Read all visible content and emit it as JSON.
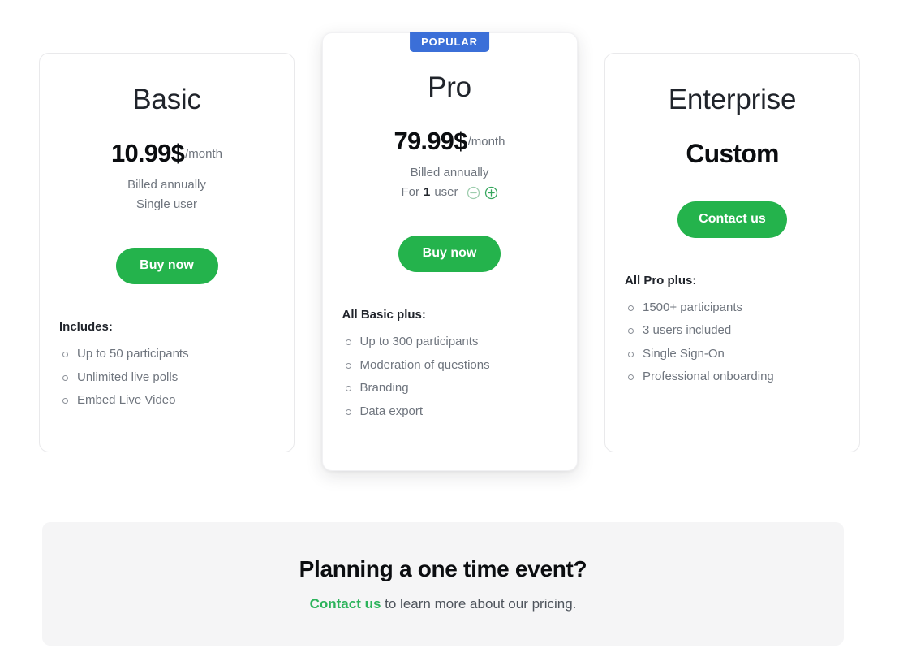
{
  "plans": [
    {
      "id": "basic",
      "name": "Basic",
      "featured": false,
      "badge": null,
      "price_amount": "10.99$",
      "price_period": "/month",
      "billing_note": "Billed annually",
      "seat_note": "Single user",
      "has_stepper": false,
      "cta_label": "Buy now",
      "features_title": "Includes:",
      "features": [
        "Up to 50 participants",
        "Unlimited live polls",
        "Embed Live Video"
      ]
    },
    {
      "id": "pro",
      "name": "Pro",
      "featured": true,
      "badge": "POPULAR",
      "price_amount": "79.99$",
      "price_period": "/month",
      "billing_note": "Billed annually",
      "seat_prefix": "For",
      "seat_count": "1",
      "seat_suffix": "user",
      "has_stepper": true,
      "decrement_label": "−",
      "increment_label": "+",
      "cta_label": "Buy now",
      "features_title": "All Basic plus:",
      "features": [
        "Up to 300 participants",
        "Moderation of questions",
        "Branding",
        "Data export"
      ]
    },
    {
      "id": "enterprise",
      "name": "Enterprise",
      "featured": false,
      "badge": null,
      "price_amount": "Custom",
      "price_period": "",
      "billing_note": "",
      "seat_note": "",
      "has_stepper": false,
      "cta_label": "Contact us",
      "features_title": "All Pro plus:",
      "features": [
        "1500+ participants",
        "3 users included",
        "Single Sign-On",
        "Professional onboarding"
      ]
    }
  ],
  "banner": {
    "title": "Planning a one time event?",
    "link_text": "Contact us",
    "rest_text": " to learn more about our pricing."
  },
  "colors": {
    "cta_green": "#24b34c",
    "link_green": "#2cb35b",
    "badge_blue": "#3b6fd8",
    "stepper_plus": "#35a65d",
    "stepper_minus": "#9ecdae",
    "banner_bg": "#f5f5f6",
    "text_dark": "#0b0d10",
    "text_muted": "#6f757e"
  }
}
